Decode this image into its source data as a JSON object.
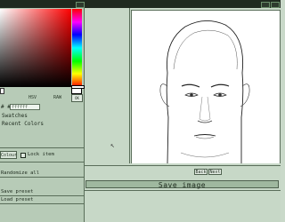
{
  "picker": {
    "hue_label": "HSV",
    "raw_label": "RAW",
    "ok_label": "OK",
    "hex_prefix": "# #",
    "hex_value": "ffffff"
  },
  "panel": {
    "swatches_label": "Swatches",
    "recent_colors_label": "Recent Colors",
    "colour_button": "Colour",
    "lock_item_label": "Lock item",
    "randomize_all": "Randomize all",
    "save_preset": "Save preset",
    "load_preset": "Load preset"
  },
  "controls": {
    "back_label": "Back",
    "next_label": "Next",
    "save_image": "Save image"
  },
  "colors": {
    "panel_bg": "#b7cbb7",
    "accent": "#9fb89f"
  }
}
